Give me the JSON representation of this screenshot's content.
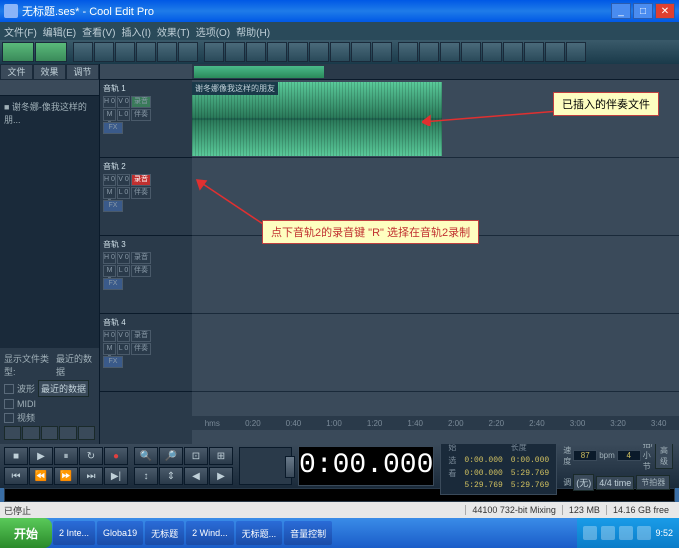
{
  "window": {
    "title": "无标题.ses* - Cool Edit Pro",
    "min": "_",
    "max": "□",
    "close": "✕"
  },
  "menu": [
    "文件(F)",
    "编辑(E)",
    "查看(V)",
    "插入(I)",
    "效果(T)",
    "选项(O)",
    "帮助(H)"
  ],
  "tabs": [
    "文件",
    "效果",
    "调节"
  ],
  "fileitem": "■ 谢冬娜-像我这样的朋...",
  "filetype_label": "显示文件类型:",
  "recent_label": "最近的数据",
  "ft1": "波形",
  "ft2": "MIDI",
  "ft3": "视频",
  "tracks": [
    {
      "name": "音轨 1",
      "h": "H 0",
      "v": "V 0",
      "m": "M 0",
      "l": "L 0",
      "r": "录音",
      "b2": "伴奏",
      "fx": "FX"
    },
    {
      "name": "音轨 2",
      "h": "H 0",
      "v": "V 0",
      "m": "M 0",
      "l": "L 0",
      "r": "录音",
      "b2": "伴奏",
      "fx": "FX"
    },
    {
      "name": "音轨 3",
      "h": "H 0",
      "v": "V 0",
      "m": "M 0",
      "l": "L 0",
      "r": "录音",
      "b2": "伴奏",
      "fx": "FX"
    },
    {
      "name": "音轨 4",
      "h": "H 0",
      "v": "V 0",
      "m": "M 0",
      "l": "L 0",
      "r": "录音",
      "b2": "伴奏",
      "fx": "FX"
    }
  ],
  "wave_title": "谢冬娜像我这样的朋友",
  "ruler": [
    "hms",
    "0:20",
    "0:40",
    "1:00",
    "1:20",
    "1:40",
    "2:00",
    "2:20",
    "2:40",
    "3:00",
    "3:20",
    "3:40"
  ],
  "callout1": "已插入的伴奏文件",
  "callout2": "点下音轨2的录音键 \"R\" 选择在音轨2录制",
  "time": "0:00.000",
  "pos": {
    "lbl_pos": "始",
    "lbl_sel": "选",
    "lbl_view": "看",
    "lbl_len": "长度",
    "pos_begin": "0:00.000",
    "sel_begin": "0:00.000",
    "sel_end": "5:29.769",
    "sel_len": "0:00.000",
    "view_begin": "5:29.769",
    "view_len": "5:29.769"
  },
  "tempo": {
    "lbl_speed": "速度",
    "bpm": "87",
    "bpm_lbl": "bpm",
    "beat": "4",
    "beat_lbl": "拍/小节",
    "adv": "高级",
    "lbl_key": "调",
    "key": "(无)",
    "sig": "4/4 time",
    "metro": "节拍器"
  },
  "status": {
    "stopped": "已停止",
    "rate": "44100 732-bit Mixing",
    "mem": "123 MB",
    "disk": "14.16 GB free"
  },
  "taskbar": {
    "start": "开始",
    "items": [
      "2 Inte...",
      "Globa19",
      "无标题",
      "2 Wind...",
      "无标题...",
      "音量控制"
    ],
    "time": "9:52"
  }
}
